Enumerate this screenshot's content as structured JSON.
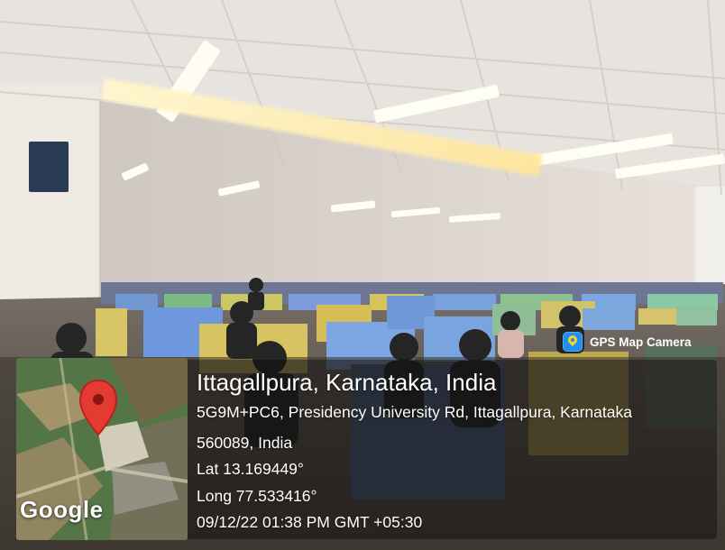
{
  "overlay": {
    "badge": "GPS Map Camera",
    "title": "Ittagallpura, Karnataka, India",
    "address_line_1": "5G9M+PC6, Presidency University Rd, Ittagallpura, Karnataka",
    "address_line_2": "560089, India",
    "latitude": "Lat 13.169449°",
    "longitude": "Long 77.533416°",
    "timestamp": "09/12/22 01:38 PM GMT +05:30",
    "map_logo": "Google"
  },
  "icons": {
    "badge_icon": "gps-map-camera-icon",
    "pin_icon": "location-pin-icon"
  },
  "colors": {
    "badge_blue": "#1f8ff0",
    "badge_yellow": "#ffcf24",
    "pin_red": "#e43b30",
    "panel": "rgba(0,0,0,0.36)"
  }
}
